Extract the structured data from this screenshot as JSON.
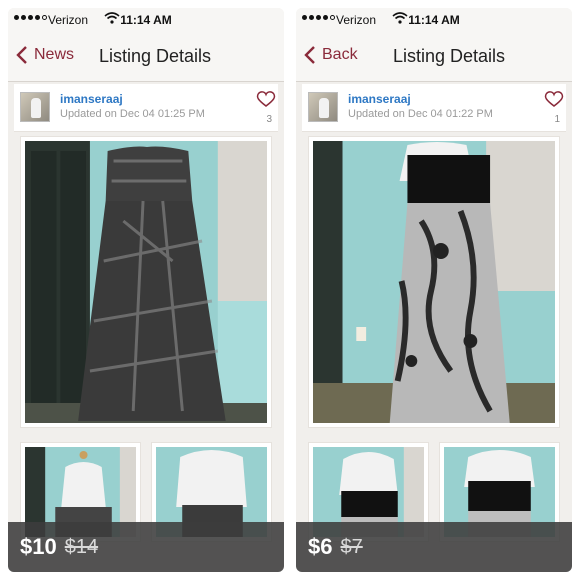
{
  "listings": [
    {
      "status": {
        "carrier": "Verizon",
        "time": "11:14 AM"
      },
      "nav": {
        "back_label": "News",
        "title": "Listing Details"
      },
      "seller": {
        "username": "imanseraaj",
        "updated": "Updated on Dec 04 01:25 PM",
        "likes": "3"
      },
      "price": {
        "current": "$10",
        "original": "$14"
      }
    },
    {
      "status": {
        "carrier": "Verizon",
        "time": "11:14 AM"
      },
      "nav": {
        "back_label": "Back",
        "title": "Listing Details"
      },
      "seller": {
        "username": "imanseraaj",
        "updated": "Updated on Dec 04 01:22 PM",
        "likes": "1"
      },
      "price": {
        "current": "$6",
        "original": "$7"
      }
    }
  ],
  "colors": {
    "accent": "#8a2a3a",
    "link": "#2e78c4",
    "wall": "#9fd3d3"
  }
}
